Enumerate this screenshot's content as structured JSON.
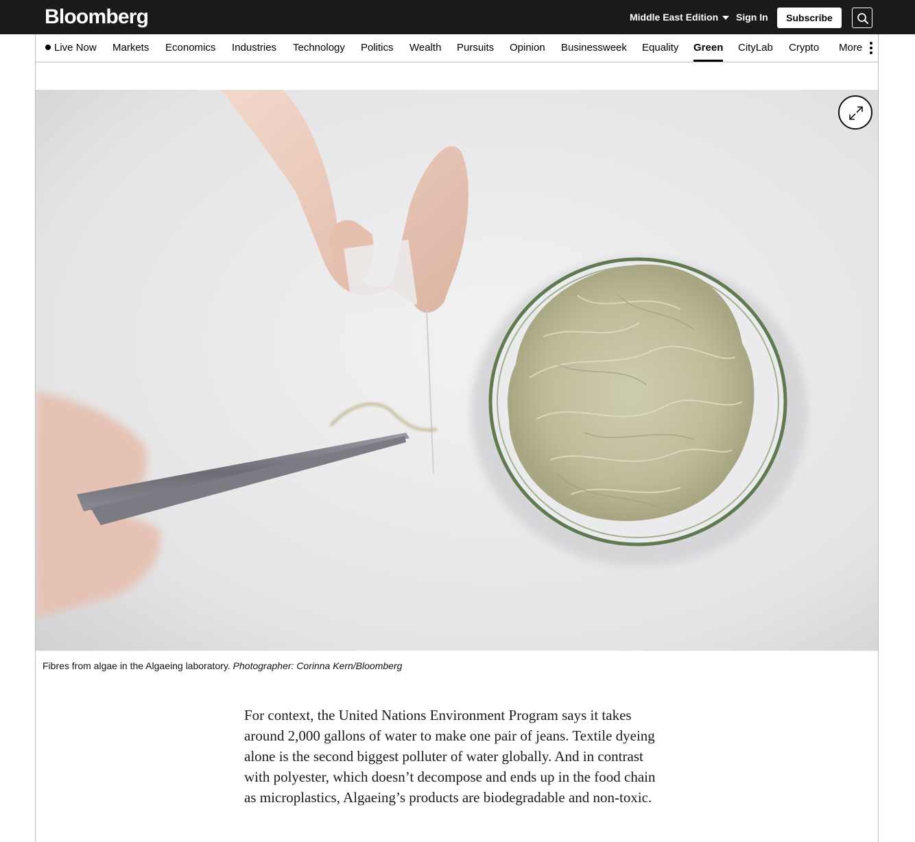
{
  "header": {
    "logo": "Bloomberg",
    "edition_label": "Middle East Edition",
    "signin_label": "Sign In",
    "subscribe_label": "Subscribe",
    "search_icon": "search-icon"
  },
  "nav": {
    "items": [
      {
        "label": "Live Now",
        "active": false
      },
      {
        "label": "Markets",
        "active": false
      },
      {
        "label": "Economics",
        "active": false
      },
      {
        "label": "Industries",
        "active": false
      },
      {
        "label": "Technology",
        "active": false
      },
      {
        "label": "Politics",
        "active": false
      },
      {
        "label": "Wealth",
        "active": false
      },
      {
        "label": "Pursuits",
        "active": false
      },
      {
        "label": "Opinion",
        "active": false
      },
      {
        "label": "Businessweek",
        "active": false
      },
      {
        "label": "Equality",
        "active": false
      },
      {
        "label": "Green",
        "active": true
      },
      {
        "label": "CityLab",
        "active": false
      },
      {
        "label": "Crypto",
        "active": false
      },
      {
        "label": "More",
        "active": false
      }
    ]
  },
  "photo": {
    "expand_icon": "expand-icon",
    "caption": "Fibres from algae in the Algaeing laboratory.",
    "credit": "Photographer: Corinna Kern/Bloomberg"
  },
  "article": {
    "paragraph": "For context, the United Nations Environment Program says it takes around 2,000 gallons of water to make one pair of jeans. Textile dyeing alone is the second biggest polluter of water globally. And in contrast with polyester, which doesn’t decompose and ends up in the food chain as microplastics, Algaeing’s products are biodegradable and non-toxic."
  },
  "colors": {
    "topbar": "#1a1a1a",
    "background": "#ffffff",
    "fibre": "#c9c7a8",
    "dish_rim": "#5e7a4e"
  }
}
